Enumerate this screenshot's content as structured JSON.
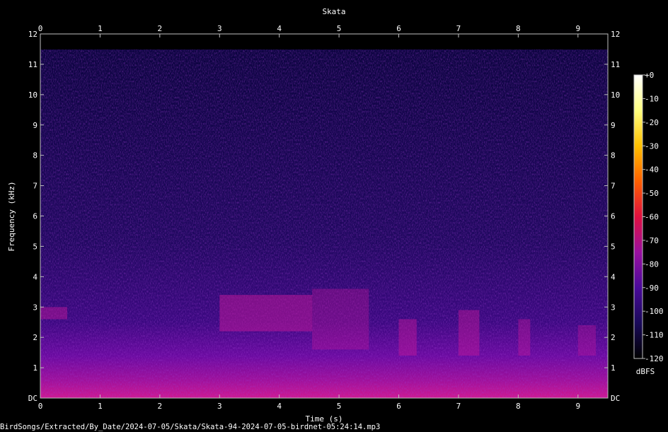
{
  "chart_data": {
    "type": "heatmap",
    "title": "Skata",
    "xlabel": "Time (s)",
    "ylabel": "Frequency (kHz)",
    "xlim": [
      0,
      9.5
    ],
    "ylim": [
      0,
      12
    ],
    "x_ticks": [
      "0",
      "1",
      "2",
      "3",
      "4",
      "5",
      "6",
      "7",
      "8",
      "9"
    ],
    "y_ticks": [
      "DC",
      "1",
      "2",
      "3",
      "4",
      "5",
      "6",
      "7",
      "8",
      "9",
      "10",
      "11",
      "12"
    ],
    "colorbar": {
      "label": "dBFS",
      "range": [
        -120,
        0
      ],
      "ticks": [
        "+0",
        "-10",
        "-20",
        "-30",
        "-40",
        "-50",
        "-60",
        "-70",
        "-80",
        "-90",
        "-100",
        "-110",
        "-120"
      ],
      "colors": [
        "#000000",
        "#1a0a5a",
        "#4a0a9a",
        "#9a10a0",
        "#e01040",
        "#ff6000",
        "#ffc000",
        "#ffff80",
        "#ffffff"
      ]
    },
    "features": [
      {
        "t": [
          0,
          0.45
        ],
        "f": [
          2.6,
          3.0
        ],
        "level": 0.45
      },
      {
        "t": [
          3.0,
          4.55
        ],
        "f": [
          2.2,
          3.4
        ],
        "level": 0.5
      },
      {
        "t": [
          4.55,
          5.5
        ],
        "f": [
          1.6,
          3.6
        ],
        "level": 0.35
      },
      {
        "t": [
          6.0,
          6.3
        ],
        "f": [
          1.4,
          2.6
        ],
        "level": 0.45
      },
      {
        "t": [
          7.0,
          7.35
        ],
        "f": [
          1.4,
          2.9
        ],
        "level": 0.45
      },
      {
        "t": [
          8.0,
          8.2
        ],
        "f": [
          1.4,
          2.6
        ],
        "level": 0.4
      },
      {
        "t": [
          9.0,
          9.3
        ],
        "f": [
          1.4,
          2.4
        ],
        "level": 0.35
      }
    ],
    "grid": false,
    "legend": "right"
  },
  "footer": {
    "filename": "BirdSongs/Extracted/By_Date/2024-07-05/Skata/Skata-94-2024-07-05-birdnet-05:24:14.mp3"
  }
}
